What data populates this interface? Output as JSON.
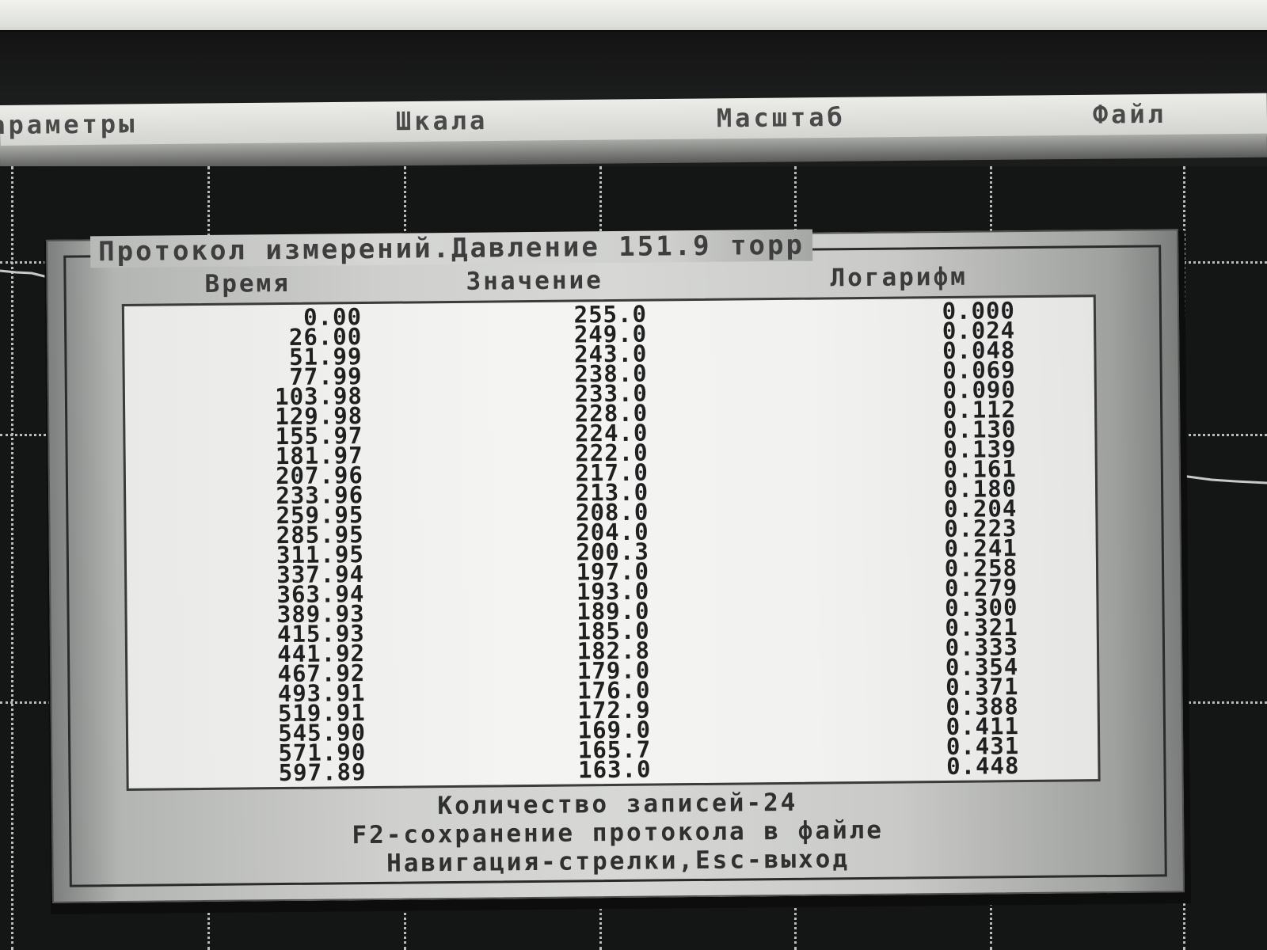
{
  "menu": {
    "items": [
      {
        "label": "Параметры"
      },
      {
        "label": "Шкала"
      },
      {
        "label": "Масштаб"
      },
      {
        "label": "Файл"
      }
    ]
  },
  "dialog": {
    "title": "Протокол измерений.Давление 151.9 торр",
    "columns": {
      "time": "Время",
      "value": "Значение",
      "log": "Логарифм"
    },
    "rows": [
      {
        "time": "0.00",
        "value": "255.0",
        "log": "0.000"
      },
      {
        "time": "26.00",
        "value": "249.0",
        "log": "0.024"
      },
      {
        "time": "51.99",
        "value": "243.0",
        "log": "0.048"
      },
      {
        "time": "77.99",
        "value": "238.0",
        "log": "0.069"
      },
      {
        "time": "103.98",
        "value": "233.0",
        "log": "0.090"
      },
      {
        "time": "129.98",
        "value": "228.0",
        "log": "0.112"
      },
      {
        "time": "155.97",
        "value": "224.0",
        "log": "0.130"
      },
      {
        "time": "181.97",
        "value": "222.0",
        "log": "0.139"
      },
      {
        "time": "207.96",
        "value": "217.0",
        "log": "0.161"
      },
      {
        "time": "233.96",
        "value": "213.0",
        "log": "0.180"
      },
      {
        "time": "259.95",
        "value": "208.0",
        "log": "0.204"
      },
      {
        "time": "285.95",
        "value": "204.0",
        "log": "0.223"
      },
      {
        "time": "311.95",
        "value": "200.3",
        "log": "0.241"
      },
      {
        "time": "337.94",
        "value": "197.0",
        "log": "0.258"
      },
      {
        "time": "363.94",
        "value": "193.0",
        "log": "0.279"
      },
      {
        "time": "389.93",
        "value": "189.0",
        "log": "0.300"
      },
      {
        "time": "415.93",
        "value": "185.0",
        "log": "0.321"
      },
      {
        "time": "441.92",
        "value": "182.8",
        "log": "0.333"
      },
      {
        "time": "467.92",
        "value": "179.0",
        "log": "0.354"
      },
      {
        "time": "493.91",
        "value": "176.0",
        "log": "0.371"
      },
      {
        "time": "519.91",
        "value": "172.9",
        "log": "0.388"
      },
      {
        "time": "545.90",
        "value": "169.0",
        "log": "0.411"
      },
      {
        "time": "571.90",
        "value": "165.7",
        "log": "0.431"
      },
      {
        "time": "597.89",
        "value": "163.0",
        "log": "0.448"
      }
    ],
    "footer": {
      "count": "Количество записей-24",
      "save_hint": "F2-сохранение протокола в файле",
      "nav_hint": "Навигация-стрелки,Esc-выход"
    }
  },
  "colors": {
    "screen_background": "#141515",
    "dialog_background": "#d7d8d6",
    "table_background": "#f2f2f0",
    "text": "#1f2020",
    "grid": "#b9bcba"
  }
}
